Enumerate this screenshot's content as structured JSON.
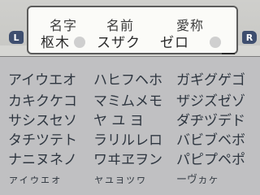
{
  "header": {
    "labels": {
      "surname": "名字",
      "given": "名前",
      "nickname": "愛称"
    },
    "values": {
      "surname": "枢木",
      "given": "スザク",
      "nickname": "ゼロ"
    },
    "shoulder_left": "L",
    "shoulder_right": "R"
  },
  "keyboard": {
    "rows": [
      [
        "アイウエオ",
        "ハヒフヘホ",
        "ガギグゲゴ"
      ],
      [
        "カキクケコ",
        "マミムメモ",
        "ザジズゼゾ"
      ],
      [
        "サシスセソ",
        "ヤ ユ ヨ",
        "ダヂヅデド"
      ],
      [
        "タチツテト",
        "ラリルレロ",
        "バビブベボ"
      ],
      [
        "ナニヌネノ",
        "ワヰヱヲン",
        "パピプペポ"
      ],
      [
        "ァィゥェォ",
        "ャュョッヮ",
        "ーヴヵヶ"
      ]
    ]
  }
}
